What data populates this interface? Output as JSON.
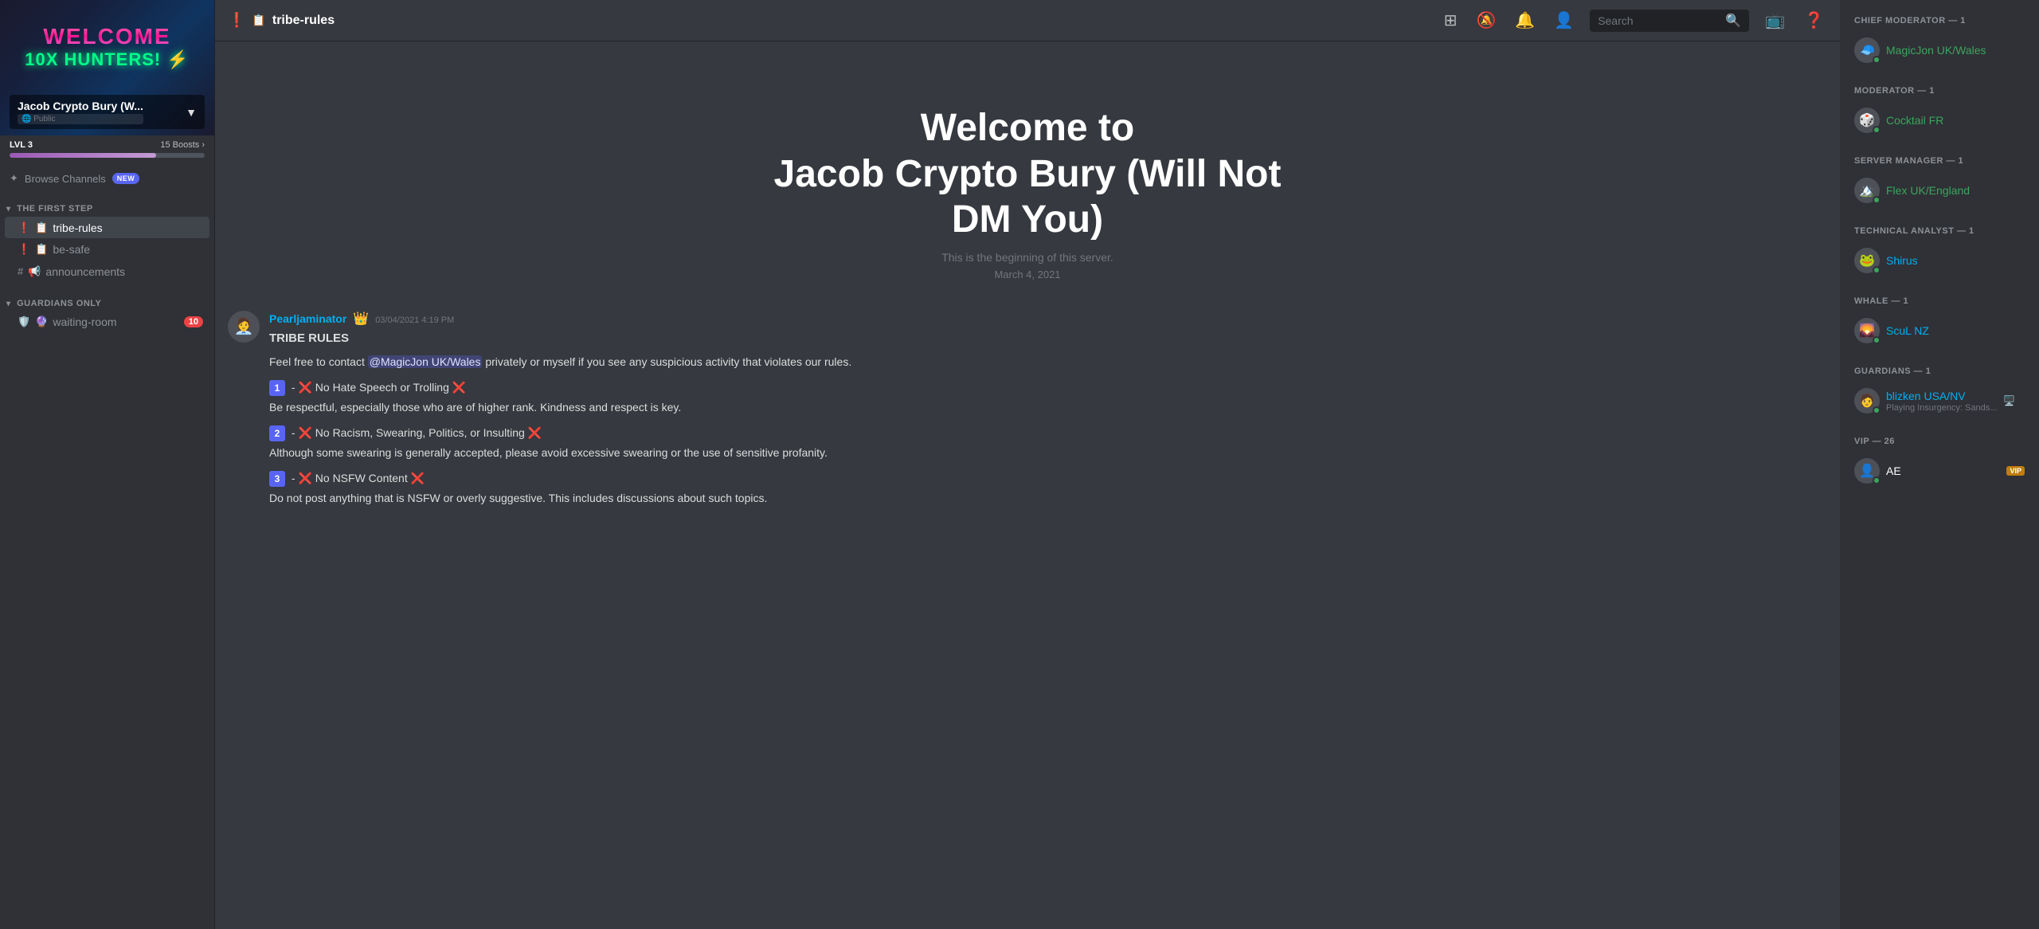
{
  "server": {
    "name": "Jacob Crypto Bury (W...",
    "name_full": "Jacob Crypto Bury (Will Not DM You)",
    "public_label": "🌐 Public",
    "level": "LVL 3",
    "boosts": "15 Boosts",
    "boost_arrow": "›",
    "banner_welcome": "WELCOME",
    "banner_hunters": "10X HUNTERS! ⚡",
    "boost_progress": 75
  },
  "browse_channels": {
    "label": "Browse Channels",
    "new_badge": "NEW"
  },
  "sidebar": {
    "sections": [
      {
        "name": "THE FIRST STEP",
        "channels": [
          {
            "id": "tribe-rules",
            "prefix": "📋",
            "name": "tribe-rules",
            "icon": "📋",
            "type": "text",
            "alert": true,
            "active": true
          },
          {
            "id": "be-safe",
            "prefix": "📋",
            "name": "be-safe",
            "icon": "📋",
            "type": "text",
            "alert": true
          },
          {
            "id": "announcements",
            "prefix": "📢",
            "name": "announcements",
            "icon": "📢",
            "type": "text"
          }
        ]
      },
      {
        "name": "GUARDIANS ONLY",
        "channels": [
          {
            "id": "waiting-room",
            "prefix": "🛡️",
            "name": "waiting-room",
            "icon": "🛡️",
            "type": "text",
            "notification": 10
          }
        ]
      }
    ]
  },
  "channel_header": {
    "icon": "📋",
    "alert_icon": "❗",
    "name": "tribe-rules",
    "search_placeholder": "Search"
  },
  "welcome": {
    "line1": "Welcome to",
    "line2": "Jacob Crypto Bury (Will Not",
    "line3": "DM You)",
    "subtitle": "This is the beginning of this server.",
    "date": "March 4, 2021"
  },
  "message": {
    "author": "Pearljaminator",
    "author_badge": "👑",
    "timestamp": "03/04/2021 4:19 PM",
    "title": "TRIBE RULES",
    "intro": "Feel free to contact",
    "mention": "@MagicJon UK/Wales",
    "intro2": "privately or myself if you see any suspicious activity that violates our rules.",
    "rules": [
      {
        "num": "1",
        "emoji_l": "❌",
        "text": "No Hate Speech or Trolling",
        "emoji_r": "❌",
        "desc": "Be respectful, especially those who are of higher rank. Kindness and respect is key."
      },
      {
        "num": "2",
        "emoji_l": "❌",
        "text": "No Racism, Swearing, Politics, or Insulting",
        "emoji_r": "❌",
        "desc": "Although some swearing is generally accepted, please avoid excessive swearing or the use of sensitive profanity."
      },
      {
        "num": "3",
        "emoji_l": "❌",
        "text": "No NSFW Content",
        "emoji_r": "❌",
        "desc": "Do not post anything that is NSFW or overly suggestive. This includes discussions about such topics."
      }
    ]
  },
  "members": {
    "groups": [
      {
        "role": "CHIEF MODERATOR — 1",
        "members": [
          {
            "name": "MagicJon UK/Wales",
            "color": "green",
            "avatar": "🧢",
            "status": "online"
          }
        ]
      },
      {
        "role": "MODERATOR — 1",
        "members": [
          {
            "name": "Cocktail FR",
            "color": "green",
            "avatar": "🎲",
            "status": "online"
          }
        ]
      },
      {
        "role": "SERVER MANAGER — 1",
        "members": [
          {
            "name": "Flex UK/England",
            "color": "green",
            "avatar": "🏔️",
            "status": "online"
          }
        ]
      },
      {
        "role": "TECHNICAL ANALYST — 1",
        "members": [
          {
            "name": "Shirus",
            "color": "teal",
            "avatar": "🐸",
            "status": "online"
          }
        ]
      },
      {
        "role": "WHALE — 1",
        "members": [
          {
            "name": "ScuL NZ",
            "color": "teal",
            "avatar": "🌄",
            "status": "online"
          }
        ]
      },
      {
        "role": "GUARDIANS — 1",
        "members": [
          {
            "name": "blizken USA/NV",
            "color": "teal",
            "avatar": "🧑",
            "status": "game",
            "subtext": "Playing Insurgency: Sands..."
          }
        ]
      },
      {
        "role": "VIP — 26",
        "members": [
          {
            "name": "AE",
            "color": "white",
            "avatar": "👤",
            "status": "online",
            "vip": true
          }
        ]
      }
    ]
  }
}
